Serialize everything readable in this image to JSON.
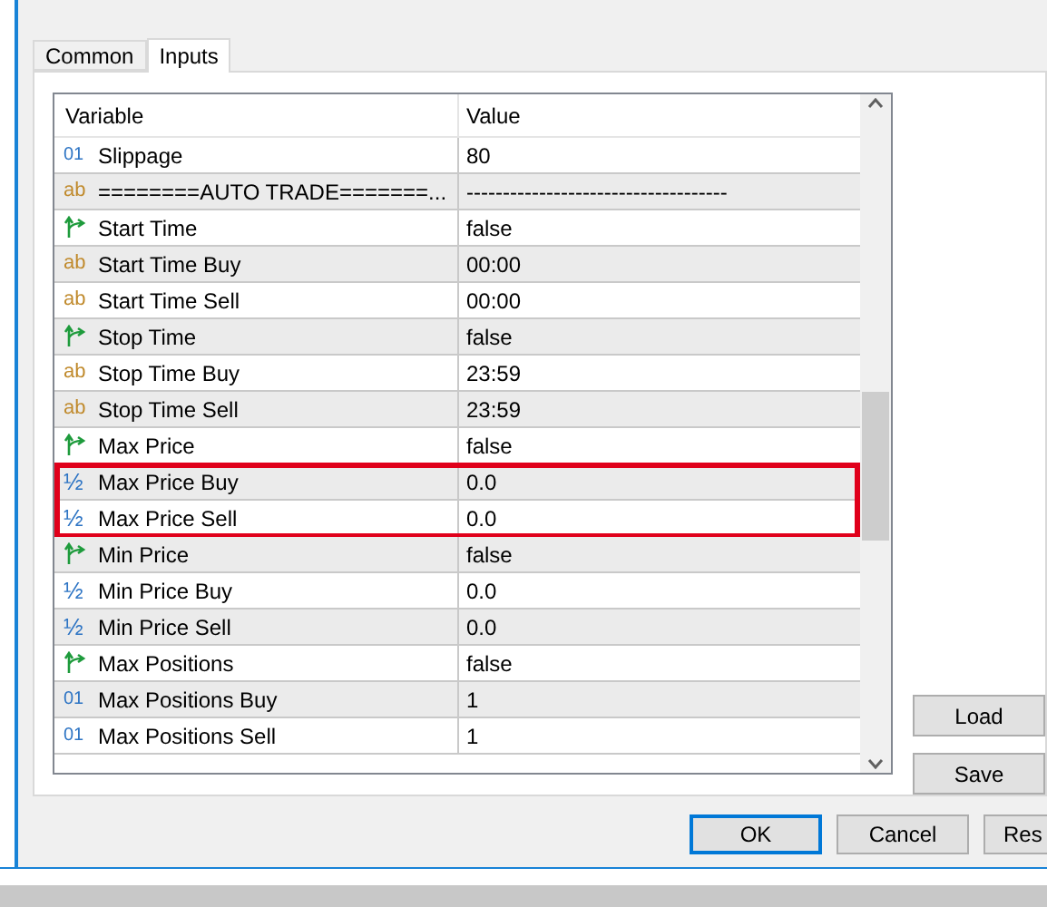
{
  "tabs": [
    {
      "label": "Common",
      "selected": false
    },
    {
      "label": "Inputs",
      "selected": true
    }
  ],
  "table": {
    "columns": [
      "Variable",
      "Value"
    ],
    "rows": [
      {
        "kind": "int",
        "icon": "01",
        "variable": "Slippage",
        "value": "80",
        "highlighted": false
      },
      {
        "kind": "string",
        "icon": "ab",
        "variable": "========AUTO TRADE=======...",
        "value": "------------------------------------",
        "highlighted": false
      },
      {
        "kind": "bool",
        "variable": "Start Time",
        "value": "false",
        "highlighted": false
      },
      {
        "kind": "string",
        "icon": "ab",
        "variable": "Start Time Buy",
        "value": "00:00",
        "highlighted": false
      },
      {
        "kind": "string",
        "icon": "ab",
        "variable": "Start Time Sell",
        "value": "00:00",
        "highlighted": false
      },
      {
        "kind": "bool",
        "variable": "Stop Time",
        "value": "false",
        "highlighted": false
      },
      {
        "kind": "string",
        "icon": "ab",
        "variable": "Stop Time Buy",
        "value": "23:59",
        "highlighted": false
      },
      {
        "kind": "string",
        "icon": "ab",
        "variable": "Stop Time Sell",
        "value": "23:59",
        "highlighted": false
      },
      {
        "kind": "bool",
        "variable": "Max Price",
        "value": "false",
        "highlighted": false
      },
      {
        "kind": "double",
        "icon": "½",
        "variable": "Max Price Buy",
        "value": "0.0",
        "highlighted": true
      },
      {
        "kind": "double",
        "icon": "½",
        "variable": "Max Price Sell",
        "value": "0.0",
        "highlighted": true
      },
      {
        "kind": "bool",
        "variable": "Min Price",
        "value": "false",
        "highlighted": false
      },
      {
        "kind": "double",
        "icon": "½",
        "variable": "Min Price Buy",
        "value": "0.0",
        "highlighted": false
      },
      {
        "kind": "double",
        "icon": "½",
        "variable": "Min Price Sell",
        "value": "0.0",
        "highlighted": false
      },
      {
        "kind": "bool",
        "variable": "Max Positions",
        "value": "false",
        "highlighted": false
      },
      {
        "kind": "int",
        "icon": "01",
        "variable": "Max Positions Buy",
        "value": "1",
        "highlighted": false
      },
      {
        "kind": "int",
        "icon": "01",
        "variable": "Max Positions Sell",
        "value": "1",
        "highlighted": false
      }
    ]
  },
  "side_buttons": [
    "Load",
    "Save"
  ],
  "buttons": [
    "OK",
    "Cancel",
    "Res"
  ]
}
